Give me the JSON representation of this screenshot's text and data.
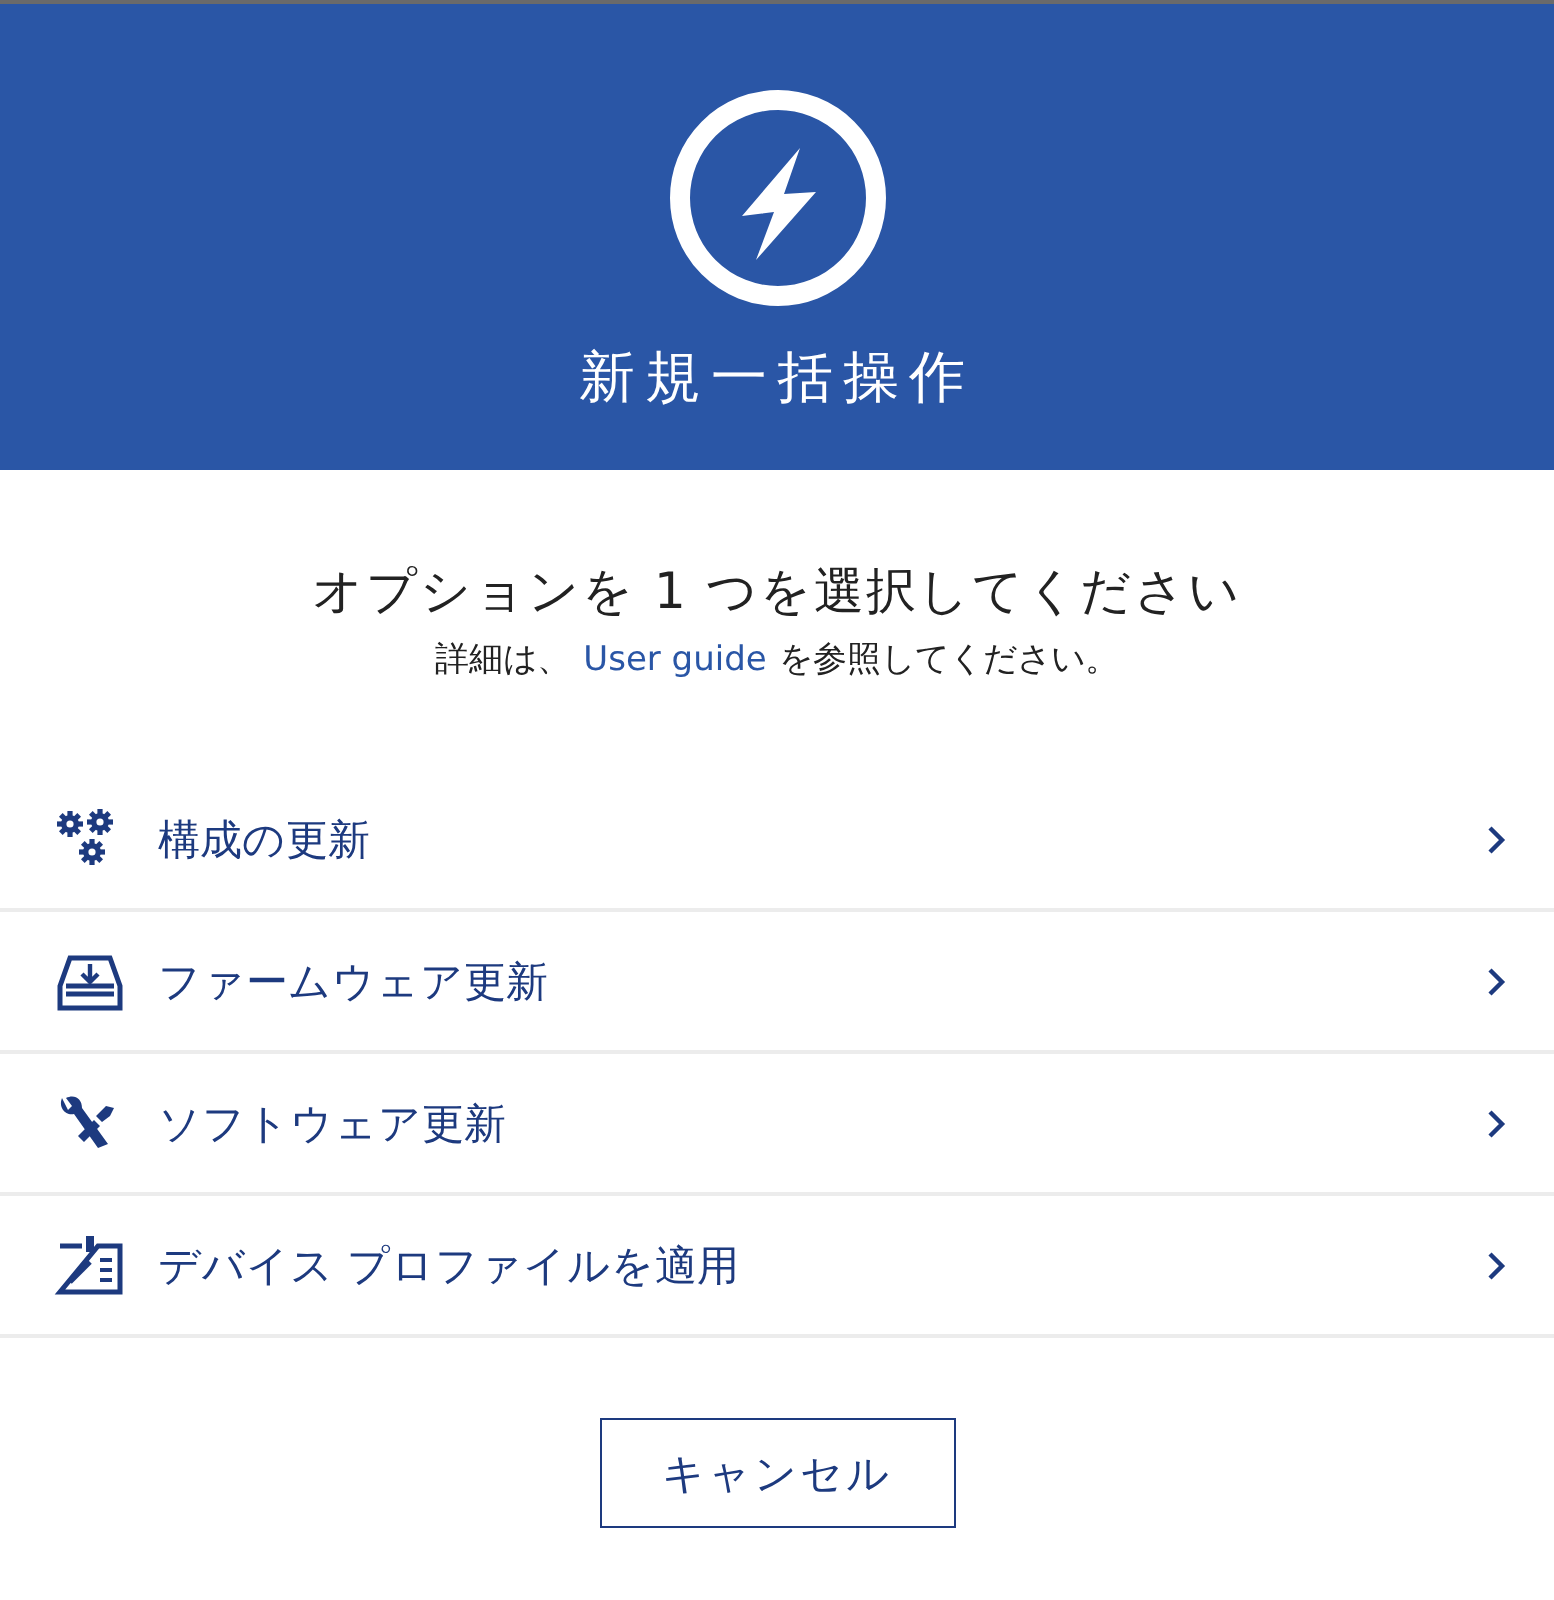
{
  "header": {
    "title": "新規一括操作"
  },
  "prompt": {
    "heading": "オプションを 1 つを選択してください",
    "detail_before": "詳細は、",
    "link": "User guide",
    "detail_after": "を参照してください。"
  },
  "options": [
    {
      "kind": "gears",
      "label": "構成の更新"
    },
    {
      "kind": "drive",
      "label": "ファームウェア更新"
    },
    {
      "kind": "tools",
      "label": "ソフトウェア更新"
    },
    {
      "kind": "profile",
      "label": "デバイス プロファイルを適用"
    }
  ],
  "buttons": [
    {
      "label": "キャンセル"
    }
  ]
}
